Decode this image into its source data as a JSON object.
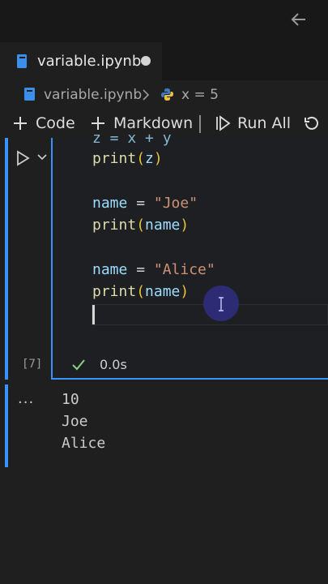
{
  "tab": {
    "label": "variable.ipynb"
  },
  "breadcrumb": {
    "file": "variable.ipynb",
    "symbol": "x = 5"
  },
  "toolbar": {
    "code_label": "Code",
    "markdown_label": "Markdown",
    "run_all_label": "Run All"
  },
  "cell": {
    "partial_top_line": "z = x + y",
    "lines": [
      {
        "fn": "print",
        "open": "(",
        "arg": "z",
        "close": ")"
      },
      {
        "var": "name",
        "op": " = ",
        "str": "\"Joe\""
      },
      {
        "fn": "print",
        "open": "(",
        "arg": "name",
        "close": ")"
      },
      {
        "var": "name",
        "op": " = ",
        "str": "\"Alice\""
      },
      {
        "fn": "print",
        "open": "(",
        "arg": "name",
        "close": ")"
      }
    ],
    "execution_count": "[7]",
    "execution_time": "0.0s"
  },
  "output": {
    "more_label": "...",
    "lines": [
      "10",
      "Joe",
      "Alice"
    ]
  },
  "colors": {
    "accent": "#3794ff",
    "check": "#89d185",
    "click": "#2e2c78"
  }
}
